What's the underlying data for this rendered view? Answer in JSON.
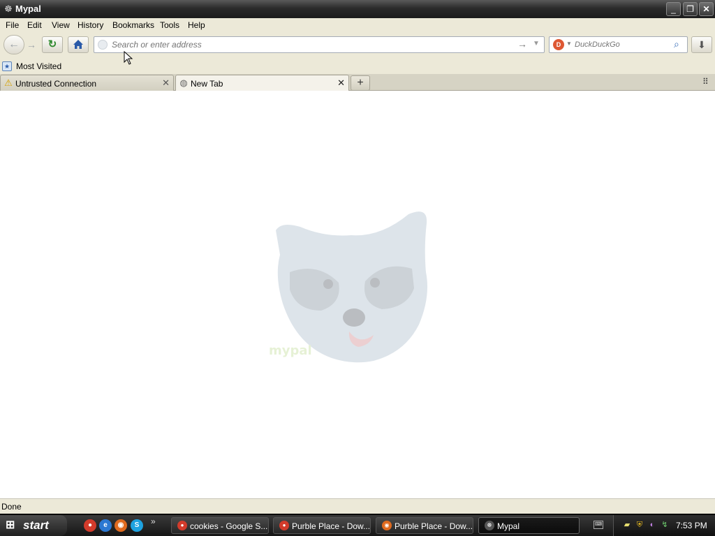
{
  "window": {
    "title": "Mypal",
    "minimize": "_",
    "maximize": "❐",
    "close": "✕"
  },
  "menu": [
    "File",
    "Edit",
    "View",
    "History",
    "Bookmarks",
    "Tools",
    "Help"
  ],
  "navbar": {
    "url_value": "",
    "url_placeholder": "Search or enter address",
    "search_engine": "DuckDuckGo",
    "search_placeholder": "DuckDuckGo"
  },
  "bookmarks": [
    {
      "label": "Most Visited"
    }
  ],
  "tabs": [
    {
      "label": "Untrusted Connection",
      "icon": "warning-icon",
      "active": false
    },
    {
      "label": "New Tab",
      "icon": "globe-icon",
      "active": true
    }
  ],
  "content": {
    "mascot": "raccoon-logo"
  },
  "status": {
    "text": "Done"
  },
  "taskbar": {
    "start_label": "start",
    "quick_launch": [
      "chrome-icon",
      "ie-icon",
      "firefox-icon",
      "skype-icon"
    ],
    "tasks": [
      {
        "label": "cookies - Google S...",
        "icon": "chrome-icon",
        "active": false
      },
      {
        "label": "Purble Place - Dow...",
        "icon": "chrome-icon",
        "active": false
      },
      {
        "label": "Purble Place - Dow...",
        "icon": "firefox-icon",
        "active": false
      },
      {
        "label": "Mypal",
        "icon": "mypal-icon",
        "active": true
      }
    ],
    "clock": "7:53 PM"
  },
  "colors": {
    "accent": "#2a5aa8",
    "taskbar": "#1c1c1c",
    "chrome_bg": "#ece9d8"
  }
}
